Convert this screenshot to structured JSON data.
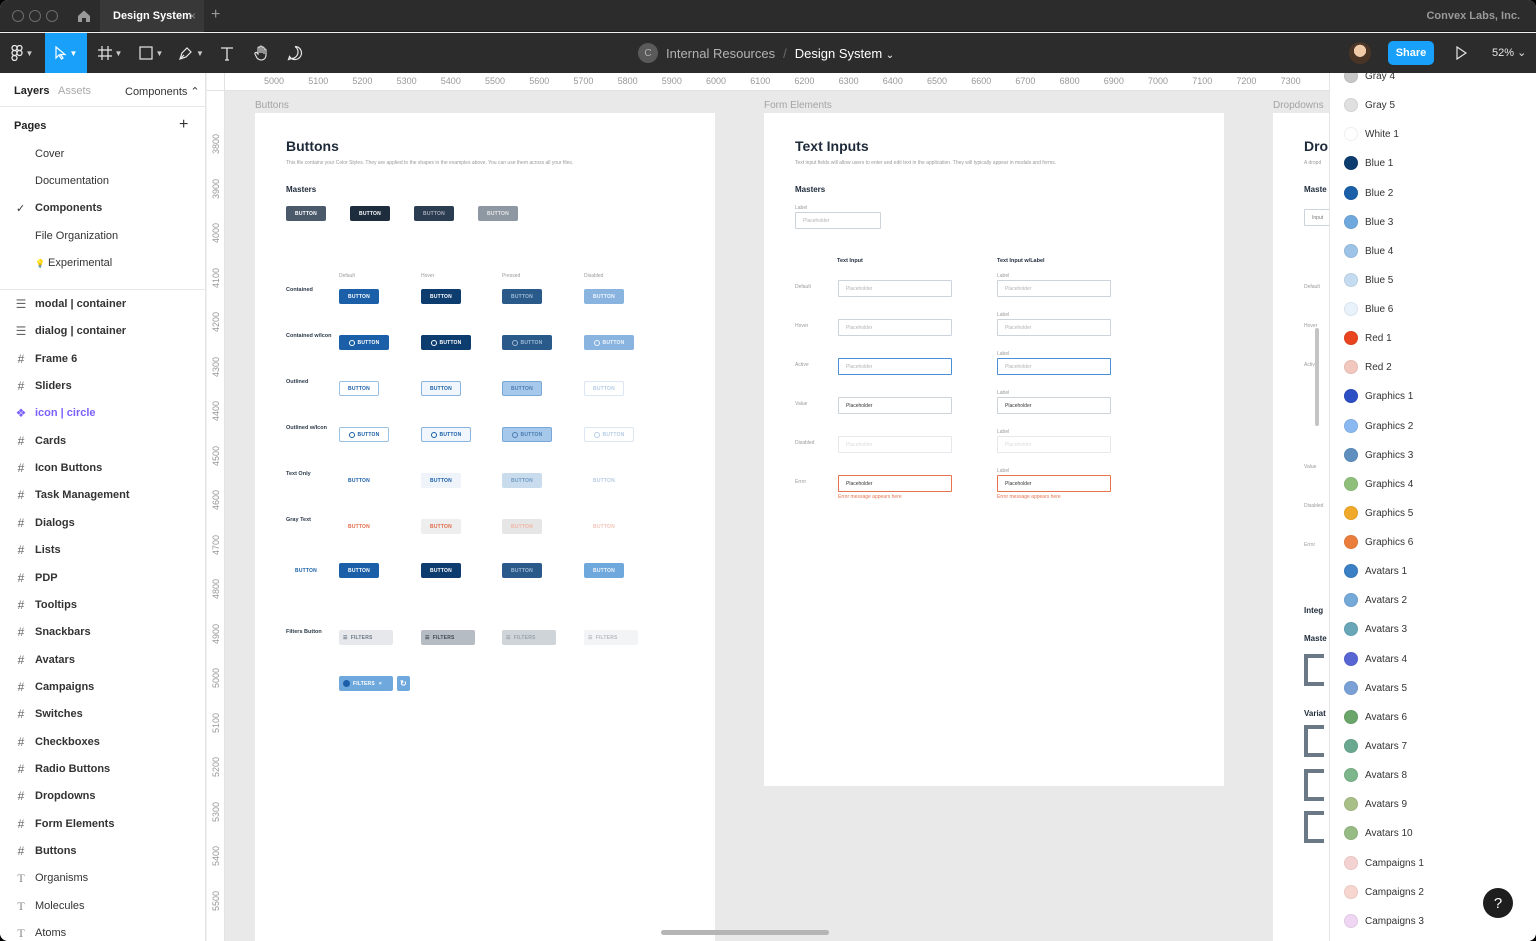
{
  "titlebar": {
    "tab_title": "Design System",
    "tab_close": "×",
    "new_tab": "+",
    "org": "Convex Labs, Inc."
  },
  "toolbar": {
    "team_initial": "C",
    "project": "Internal Resources",
    "separator": "/",
    "file": "Design System",
    "file_caret": "⌄",
    "share_label": "Share",
    "zoom": "52% ⌄"
  },
  "left_panel": {
    "tabs": {
      "layers": "Layers",
      "assets": "Assets",
      "components": "Components ⌃"
    },
    "pages_title": "Pages",
    "add_page": "+",
    "check": "✓",
    "pages": [
      "Cover",
      "Documentation",
      "Components",
      "File Organization",
      "Experimental"
    ],
    "pages_emoji": "💡",
    "layers": [
      {
        "icon": "component",
        "label": "modal | container"
      },
      {
        "icon": "component",
        "label": "dialog | container"
      },
      {
        "icon": "frame",
        "label": "Frame 6"
      },
      {
        "icon": "frame",
        "label": "Sliders"
      },
      {
        "icon": "instance",
        "label": "icon | circle"
      },
      {
        "icon": "frame",
        "label": "Cards"
      },
      {
        "icon": "frame",
        "label": "Icon Buttons"
      },
      {
        "icon": "frame",
        "label": "Task Management"
      },
      {
        "icon": "frame",
        "label": "Dialogs"
      },
      {
        "icon": "frame",
        "label": "Lists"
      },
      {
        "icon": "frame",
        "label": "PDP"
      },
      {
        "icon": "frame",
        "label": "Tooltips"
      },
      {
        "icon": "frame",
        "label": "Snackbars"
      },
      {
        "icon": "frame",
        "label": "Avatars"
      },
      {
        "icon": "frame",
        "label": "Campaigns"
      },
      {
        "icon": "frame",
        "label": "Switches"
      },
      {
        "icon": "frame",
        "label": "Checkboxes"
      },
      {
        "icon": "frame",
        "label": "Radio Buttons"
      },
      {
        "icon": "frame",
        "label": "Dropdowns"
      },
      {
        "icon": "frame",
        "label": "Form Elements"
      },
      {
        "icon": "frame",
        "label": "Buttons"
      },
      {
        "icon": "text",
        "label": "Organisms"
      },
      {
        "icon": "text",
        "label": "Molecules"
      },
      {
        "icon": "text",
        "label": "Atoms"
      }
    ]
  },
  "rulers": {
    "top": [
      "5000",
      "5100",
      "5200",
      "5300",
      "5400",
      "5500",
      "5600",
      "5700",
      "5800",
      "5900",
      "6000",
      "6100",
      "6200",
      "6300",
      "6400",
      "6500",
      "6600",
      "6700",
      "6800",
      "6900",
      "7000",
      "7100",
      "7200",
      "7300"
    ],
    "left": [
      "3800",
      "3900",
      "4000",
      "4100",
      "4200",
      "4300",
      "4400",
      "4500",
      "4600",
      "4700",
      "4800",
      "4900",
      "5000",
      "5100",
      "5200",
      "5300",
      "5400",
      "5500",
      "00"
    ]
  },
  "buttons_frame": {
    "frame_label": "Buttons",
    "title": "Buttons",
    "desc": "This file contains your Color Styles. They are applied to the shapes in the examples above. You can use them across all your files.",
    "masters_label": "Masters",
    "button_text": "BUTTON",
    "states": [
      "Default",
      "Hover",
      "Pressed",
      "Disabled"
    ],
    "rows": [
      "Contained",
      "Contained w/Icon",
      "Outlined",
      "Outlined w/Icon",
      "Text Only",
      "Gray Text",
      "",
      "Filters Button"
    ],
    "filters_text": "FILTERS",
    "filters_close": "×",
    "filters_refresh": "↻"
  },
  "inputs_frame": {
    "frame_label": "Form Elements",
    "title": "Text Inputs",
    "desc": "Text input fields will allow users to enter and edit text in the application. They will typically appear in modals and forms.",
    "masters_label": "Masters",
    "master_label": "Label",
    "placeholder": "Placeholder",
    "col1": "Text Input",
    "col2": "Text Input w/Label",
    "states": [
      "Default",
      "Hover",
      "Active",
      "Value",
      "Disabled",
      "Error"
    ],
    "field_label": "Label",
    "error_message": "Error message appears here"
  },
  "dropdowns_frame": {
    "frame_label": "Dropdowns",
    "title_partial": "Dro",
    "desc_partial": "A dropd",
    "masters_partial": "Maste",
    "input_partial": "Input",
    "states_partial": [
      "Default",
      "Hover",
      "Active",
      "Value",
      "Disabled",
      "Error"
    ],
    "integ_partial": "Integ",
    "masters2_partial": "Maste",
    "varia_partial": "Variat"
  },
  "color_styles": [
    {
      "name": "Gray 4",
      "color": "#c7c7c7"
    },
    {
      "name": "Gray 5",
      "color": "#e0e0e0"
    },
    {
      "name": "White 1",
      "color": "#ffffff"
    },
    {
      "name": "Blue 1",
      "color": "#0d3c6e"
    },
    {
      "name": "Blue 2",
      "color": "#1a5fa8"
    },
    {
      "name": "Blue 3",
      "color": "#6fa8dc"
    },
    {
      "name": "Blue 4",
      "color": "#9dc3e6"
    },
    {
      "name": "Blue 5",
      "color": "#c5dcf0"
    },
    {
      "name": "Blue 6",
      "color": "#e8f2fb"
    },
    {
      "name": "Red 1",
      "color": "#e8441f"
    },
    {
      "name": "Red 2",
      "color": "#f2c7bd"
    },
    {
      "name": "Graphics 1",
      "color": "#2d4fc4"
    },
    {
      "name": "Graphics 2",
      "color": "#8ab8f0"
    },
    {
      "name": "Graphics 3",
      "color": "#5e8fbf"
    },
    {
      "name": "Graphics 4",
      "color": "#8fbf7a"
    },
    {
      "name": "Graphics 5",
      "color": "#f0a92a"
    },
    {
      "name": "Graphics 6",
      "color": "#ea7d3c"
    },
    {
      "name": "Avatars 1",
      "color": "#3b7fc4"
    },
    {
      "name": "Avatars 2",
      "color": "#74a9d8"
    },
    {
      "name": "Avatars 3",
      "color": "#68a6b8"
    },
    {
      "name": "Avatars 4",
      "color": "#5866d4"
    },
    {
      "name": "Avatars 5",
      "color": "#7aa0d6"
    },
    {
      "name": "Avatars 6",
      "color": "#6aa56a"
    },
    {
      "name": "Avatars 7",
      "color": "#6ba890"
    },
    {
      "name": "Avatars 8",
      "color": "#7eb58a"
    },
    {
      "name": "Avatars 9",
      "color": "#a9bf88"
    },
    {
      "name": "Avatars 10",
      "color": "#97bb85"
    },
    {
      "name": "Campaigns 1",
      "color": "#f5d2d2"
    },
    {
      "name": "Campaigns 2",
      "color": "#f8d6d0"
    },
    {
      "name": "Campaigns 3",
      "color": "#efd6f2"
    }
  ],
  "help": "?"
}
